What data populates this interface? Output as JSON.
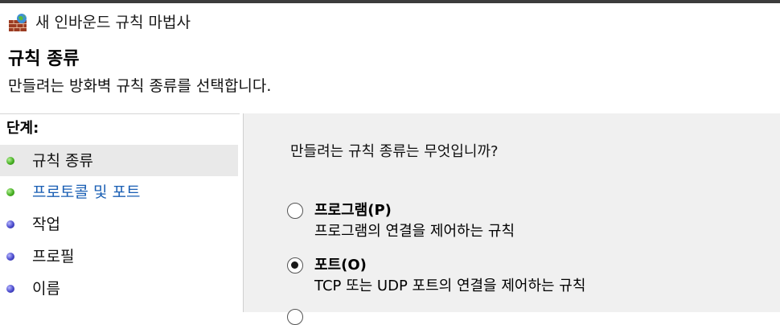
{
  "window": {
    "title": "새 인바운드 규칙 마법사",
    "icon": "firewall-icon"
  },
  "header": {
    "title": "규칙 종류",
    "description": "만들려는 방화벽 규칙 종류를 선택합니다."
  },
  "sidebar": {
    "heading": "단계:",
    "steps": [
      {
        "label": "규칙 종류",
        "state": "current",
        "color": "#46b022"
      },
      {
        "label": "프로토콜 및 포트",
        "state": "link",
        "color": "#46b022"
      },
      {
        "label": "작업",
        "state": "pending",
        "color": "#4a4acc"
      },
      {
        "label": "프로필",
        "state": "pending",
        "color": "#4a4acc"
      },
      {
        "label": "이름",
        "state": "pending",
        "color": "#4a4acc"
      }
    ]
  },
  "main": {
    "question": "만들려는 규칙 종류는 무엇입니까?",
    "options": [
      {
        "title": "프로그램(P)",
        "description": "프로그램의 연결을 제어하는 규칙",
        "selected": false
      },
      {
        "title": "포트(O)",
        "description": "TCP 또는 UDP 포트의 연결을 제어하는 규칙",
        "selected": true
      }
    ]
  },
  "colors": {
    "link": "#1a5fb4",
    "current_step_bg": "#e9e9e9",
    "panel_bg": "#f0f0f0"
  }
}
